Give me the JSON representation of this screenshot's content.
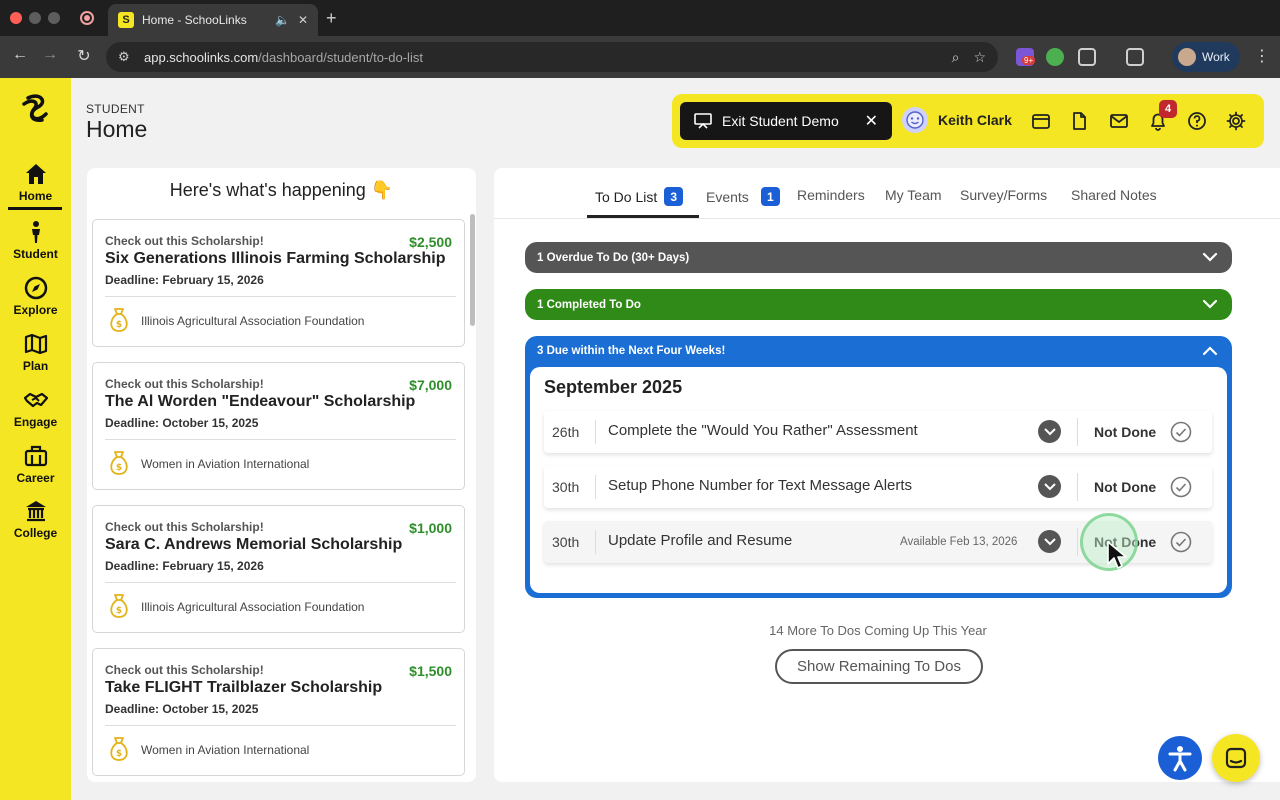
{
  "browser": {
    "tab_title": "Home - SchooLinks",
    "favicon_letter": "S",
    "url_host": "app.schoolinks.com",
    "url_path": "/dashboard/student/to-do-list",
    "extension_badge": "9+",
    "profile_name": "Work"
  },
  "sidebar": {
    "items": [
      {
        "label": "Home",
        "icon": "home-icon",
        "active": true
      },
      {
        "label": "Student",
        "icon": "person-icon"
      },
      {
        "label": "Explore",
        "icon": "compass-icon"
      },
      {
        "label": "Plan",
        "icon": "map-icon"
      },
      {
        "label": "Engage",
        "icon": "handshake-icon"
      },
      {
        "label": "Career",
        "icon": "briefcase-icon"
      },
      {
        "label": "College",
        "icon": "building-icon"
      }
    ],
    "brand_color": "#f5e623"
  },
  "header": {
    "eyebrow": "STUDENT",
    "title": "Home",
    "exit_demo_label": "Exit Student Demo",
    "user_name": "Keith Clark",
    "notification_count": "4"
  },
  "feed": {
    "title": "Here's what's happening 👇",
    "cards": [
      {
        "eyebrow": "Check out this Scholarship!",
        "amount": "$2,500",
        "name": "Six Generations Illinois Farming Scholarship",
        "deadline": "Deadline: February 15, 2026",
        "org": "Illinois Agricultural Association Foundation"
      },
      {
        "eyebrow": "Check out this Scholarship!",
        "amount": "$7,000",
        "name": "The Al Worden \"Endeavour\" Scholarship",
        "deadline": "Deadline: October 15, 2025",
        "org": "Women in Aviation International"
      },
      {
        "eyebrow": "Check out this Scholarship!",
        "amount": "$1,000",
        "name": "Sara C. Andrews Memorial Scholarship",
        "deadline": "Deadline: February 15, 2026",
        "org": "Illinois Agricultural Association Foundation"
      },
      {
        "eyebrow": "Check out this Scholarship!",
        "amount": "$1,500",
        "name": "Take FLIGHT Trailblazer Scholarship",
        "deadline": "Deadline: October 15, 2025",
        "org": "Women in Aviation International"
      }
    ]
  },
  "tabs": [
    {
      "label": "To Do List",
      "count": "3",
      "active": true
    },
    {
      "label": "Events",
      "count": "1"
    },
    {
      "label": "Reminders"
    },
    {
      "label": "My Team"
    },
    {
      "label": "Survey/Forms"
    },
    {
      "label": "Shared Notes"
    }
  ],
  "todo": {
    "overdue_label": "1 Overdue To Do (30+ Days)",
    "completed_label": "1 Completed To Do",
    "due_label": "3 Due within the Next Four Weeks!",
    "month": "September 2025",
    "items": [
      {
        "day": "26th",
        "title": "Complete the \"Would You Rather\" Assessment",
        "available": "",
        "status": "Not Done"
      },
      {
        "day": "30th",
        "title": "Setup Phone Number for Text Message Alerts",
        "available": "",
        "status": "Not Done"
      },
      {
        "day": "30th",
        "title": "Update Profile and Resume",
        "available": "Available Feb 13, 2026",
        "status": "Not Done"
      }
    ],
    "more_text": "14 More To Dos Coming Up This Year",
    "show_button": "Show Remaining To Dos"
  },
  "colors": {
    "overdue": "#555555",
    "completed": "#2f8a18",
    "due": "#1b6ed3",
    "amount": "#2e8f2a",
    "tab_count": "#1b5fd6"
  }
}
